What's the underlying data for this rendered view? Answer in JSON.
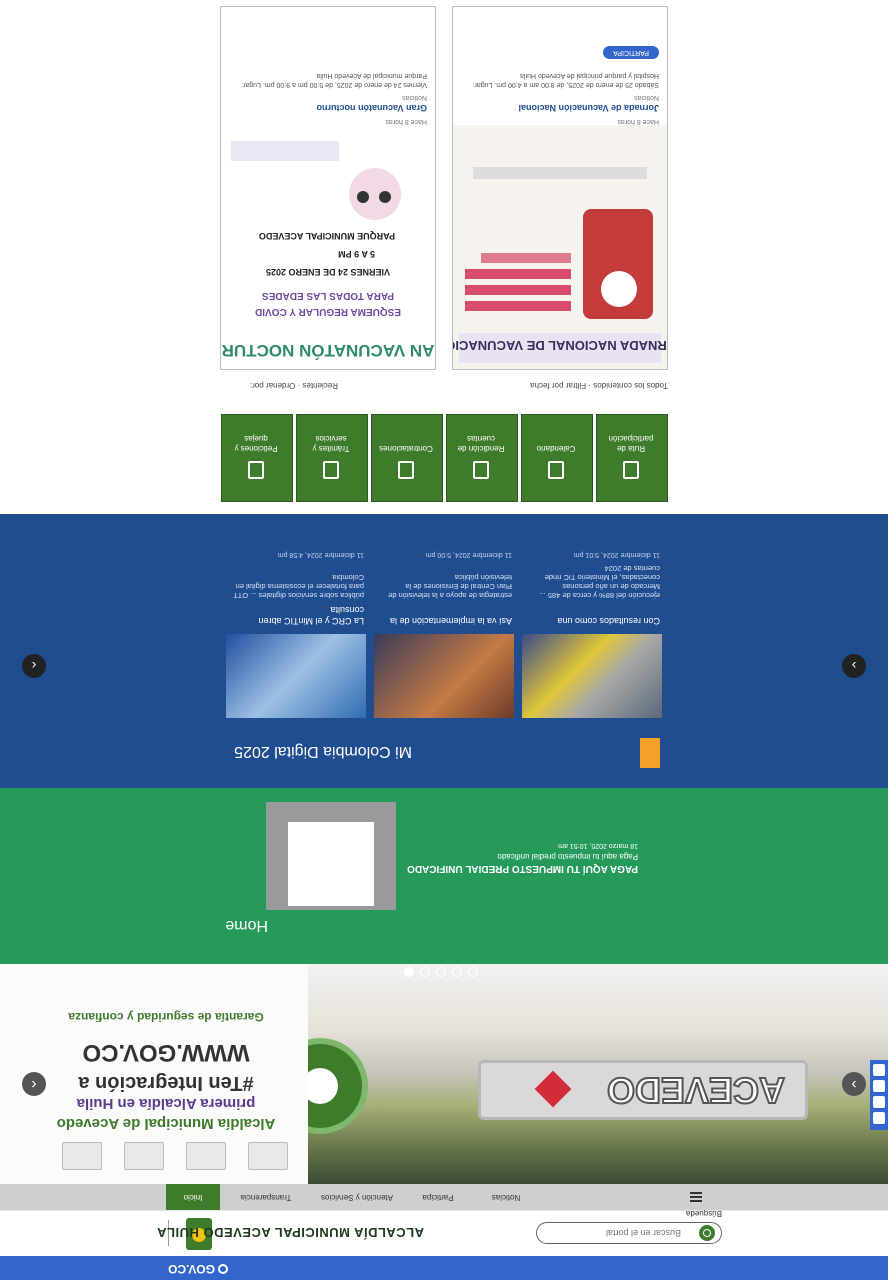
{
  "gov": {
    "logo_label": "GOV.CO"
  },
  "header": {
    "brand": "ALCALDÍA MUNICIPAL ACEVEDO HUILA",
    "search_placeholder": "Buscar en el portal",
    "advanced_search": "Búsqueda"
  },
  "nav": {
    "items": [
      "Inicio",
      "Transparencia",
      "Atención y Servicios",
      "Participa",
      "Noticias"
    ]
  },
  "hero": {
    "photo_sign": "ACEVEDO",
    "logo_strip": [
      "AIDA",
      "Logo",
      "Logo",
      "Logo"
    ],
    "line1": "Alcaldía Municipal de Acevedo",
    "line2": "primera Alcaldía en Huila",
    "line3": "#Ten Integración a",
    "line4": "WWW.GOV.CO",
    "line5": "Garantía de seguridad y confianza"
  },
  "carousel": {
    "pause_label": "Detener"
  },
  "green_section": {
    "title": "Home",
    "news_title": "PAGA AQUÍ TU IMPUESTO PREDIAL UNIFICADO",
    "news_sub": "Paga aquí tu impuesto predial unificado",
    "news_date": "18 marzo 2025, 10:51 am"
  },
  "blue_section": {
    "title": "Mi Colombia Digital 2025",
    "cards": [
      {
        "caption": "La CRC y el MinTIC abren consulta",
        "excerpt": "pública sobre servicios digitales ... OTT para fortalecer el ecosistema digital en Colombia",
        "date": "11 diciembre 2024, 4:58 pm"
      },
      {
        "caption": "Así va la implementación de la",
        "excerpt": "estrategia de apoyo a la televisión de Plan Central de Emisiones de la televisión pública",
        "date": "11 diciembre 2024, 5:00 pm"
      },
      {
        "caption": "Con resultados como una",
        "excerpt": "ejecución del 88% y cerca de 485 ... Mercado de un año personas conectadas, el Ministerio TIC rinde cuentas de 2024",
        "date": "11 diciembre 2024, 5:01 pm"
      }
    ]
  },
  "tiles": [
    {
      "label": "Ruta de participación",
      "icon": "hand-icon"
    },
    {
      "label": "Calendario",
      "icon": "calendar-icon"
    },
    {
      "label": "Rendición de cuentas",
      "icon": "chart-icon"
    },
    {
      "label": "Contrataciones",
      "icon": "document-icon"
    },
    {
      "label": "Trámites y servicios",
      "icon": "check-icon"
    },
    {
      "label": "Peticiones y quejas",
      "icon": "file-icon"
    }
  ],
  "filters": {
    "sort_label": "Ordenar por:",
    "sort_value": "Recientes",
    "filter_label": "Filtrar por fecha",
    "filter_value": "Todos los contenidos"
  },
  "posts": [
    {
      "poster_title": "JORNADA NACIONAL DE VACUNACIÓN",
      "meta": "Hace 8 horas",
      "category": "Noticias",
      "title": "Jornada de Vacunación Nacional",
      "excerpt": "Sábado 25 de enero de 2025, de 8:00 am a 4:00 pm. Lugar: Hospital y parque principal de Acevedo Huila",
      "button": "PARTICIPA"
    },
    {
      "poster_title": "GRAN VACUNATÓN NOCTURNO",
      "poster_sub": "ESQUEMA REGULAR Y COVID",
      "poster_sub2": "PARA TODAS LAS EDADES",
      "poster_date": "VIERNES 24 DE ENERO 2025",
      "poster_time": "5 A 9 PM",
      "poster_place": "PARQUE MUNICIPAL ACEVEDO",
      "meta": "Hace 8 horas",
      "category": "Noticias",
      "title": "Gran Vacunatón nocturno",
      "excerpt": "Viernes 24 de enero de 2025, de 5:00 pm a 9:00 pm. Lugar: Parque municipal de Acevedo Huila"
    }
  ]
}
